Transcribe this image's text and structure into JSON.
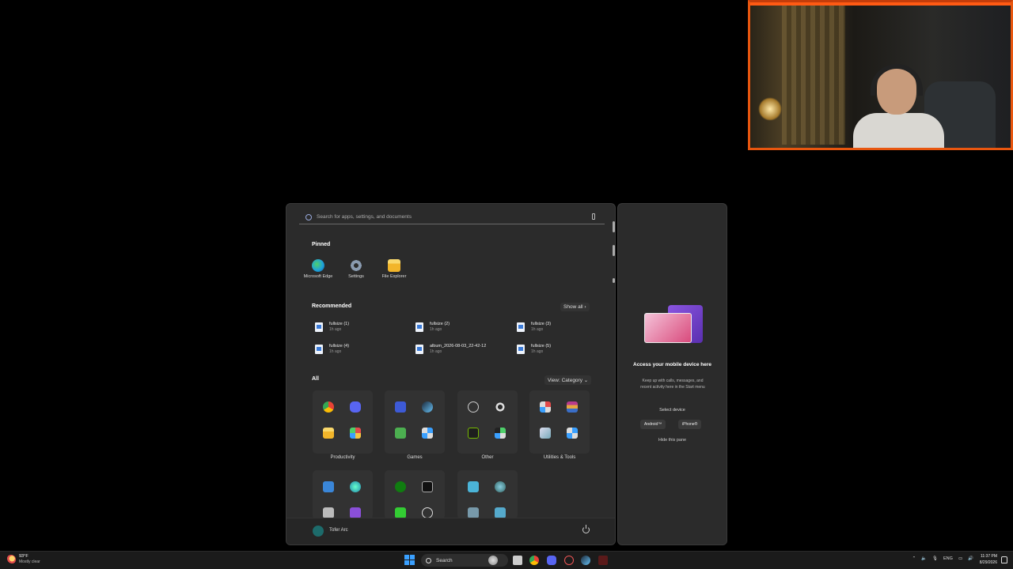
{
  "start_menu": {
    "search_placeholder": "Search for apps, settings, and documents",
    "pinned_title": "Pinned",
    "pinned": [
      {
        "label": "Microsoft Edge",
        "icon": "edge-icon",
        "color": "#1fa3d8"
      },
      {
        "label": "Settings",
        "icon": "gear-icon",
        "color": "#8a8f98"
      },
      {
        "label": "File Explorer",
        "icon": "folder-icon",
        "color": "#f5c542"
      }
    ],
    "recommended_title": "Recommended",
    "show_all_label": "Show all  ›",
    "recommended": [
      {
        "name": "fullsize (1)",
        "time": "1h ago"
      },
      {
        "name": "fullsize (2)",
        "time": "1h ago"
      },
      {
        "name": "fullsize (3)",
        "time": "1h ago"
      },
      {
        "name": "fullsize (4)",
        "time": "1h ago"
      },
      {
        "name": "album_2026-08-03_22-42-12",
        "time": "1h ago"
      },
      {
        "name": "fullsize (5)",
        "time": "1h ago"
      }
    ],
    "all_title": "All",
    "view_label": "View: Category  ⌄",
    "categories": [
      {
        "label": "Productivity",
        "icons": [
          "chrome-icon",
          "discord-icon",
          "folder-icon",
          "apps-icon"
        ]
      },
      {
        "label": "Games",
        "icons": [
          "roblox-icon",
          "steam-icon",
          "minecraft-icon",
          "apps-icon"
        ]
      },
      {
        "label": "Other",
        "icons": [
          "obs-icon",
          "steelseries-icon",
          "nvidia-icon",
          "apps-icon"
        ]
      },
      {
        "label": "Utilities & Tools",
        "icons": [
          "paint-icon",
          "winrar-icon",
          "settings-app-icon",
          "apps-icon"
        ]
      }
    ],
    "user_name": "Tofer Arc"
  },
  "phone_pane": {
    "title": "Access your mobile device here",
    "description": "Keep up with calls, messages, and recent activity here in the Start menu",
    "select_label": "Select device",
    "android_label": "Android™",
    "iphone_label": "iPhone®",
    "hide_label": "Hide this pane"
  },
  "taskbar": {
    "weather_temp": "93°F",
    "weather_desc": "Mostly clear",
    "search_label": "Search",
    "lang": "ENG",
    "time": "11:37 PM",
    "date": "8/29/2026"
  },
  "colors": {
    "accent": "#3aa0ff",
    "webcam_border": "#e8560f",
    "menu_bg": "#2b2b2b"
  }
}
